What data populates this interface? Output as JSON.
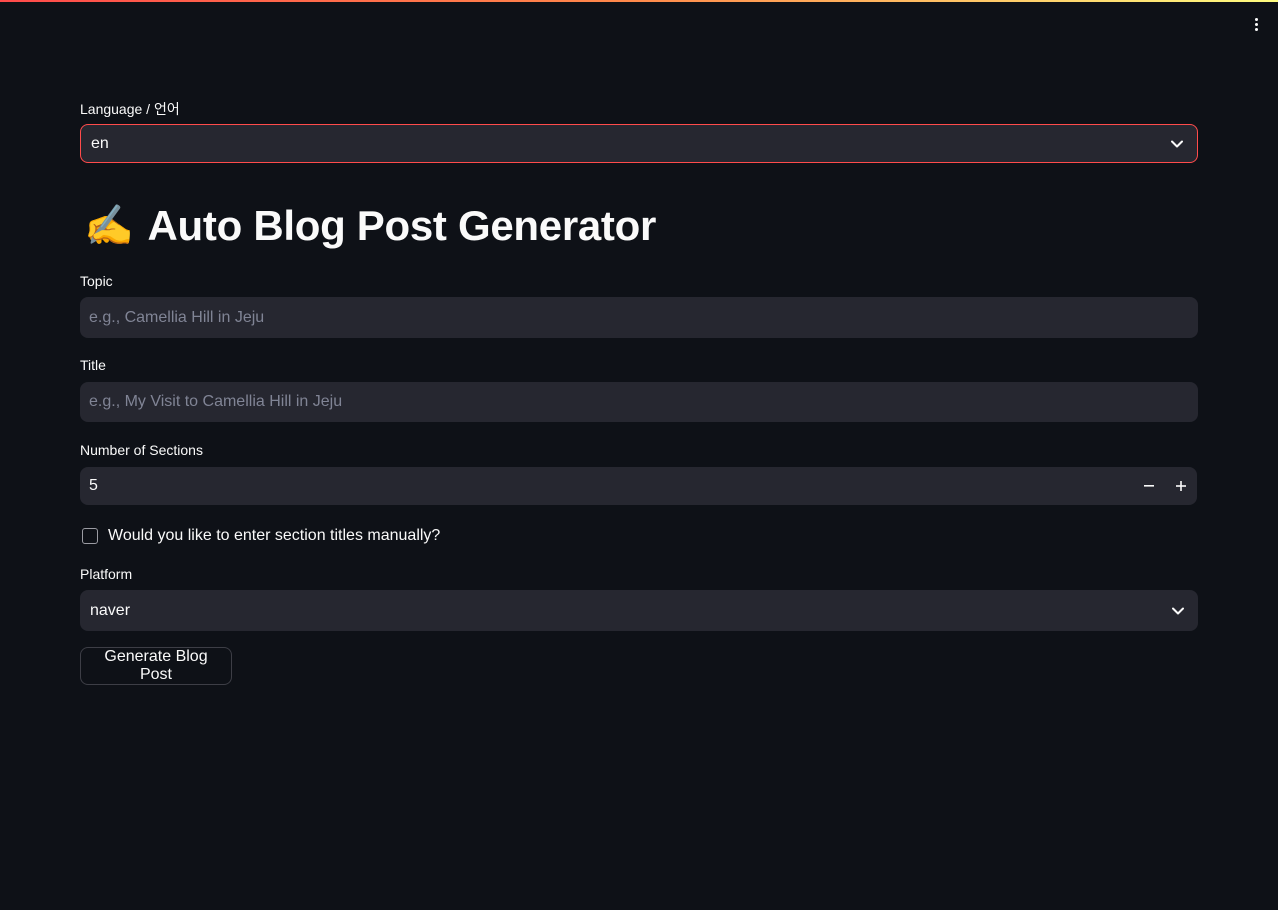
{
  "menu": {
    "icon": "vertical-ellipsis-icon"
  },
  "language": {
    "label": "Language / 언어",
    "value": "en",
    "icon": "chevron-down-icon"
  },
  "header": {
    "emoji": "✍️",
    "title": "Auto Blog Post Generator"
  },
  "topic": {
    "label": "Topic",
    "placeholder": "e.g., Camellia Hill in Jeju"
  },
  "title_field": {
    "label": "Title",
    "placeholder": "e.g., My Visit to Camellia Hill in Jeju"
  },
  "sections": {
    "label": "Number of Sections",
    "value": "5",
    "minus": "−",
    "plus": "+"
  },
  "manual_titles": {
    "label": "Would you like to enter section titles manually?"
  },
  "platform": {
    "label": "Platform",
    "value": "naver",
    "icon": "chevron-down-icon"
  },
  "actions": {
    "generate_label": "Generate Blog Post"
  },
  "colors": {
    "background": "#0e1117",
    "field_bg": "#262730",
    "accent": "#ff4b4b",
    "text": "#fafafa",
    "placeholder": "#808495"
  }
}
